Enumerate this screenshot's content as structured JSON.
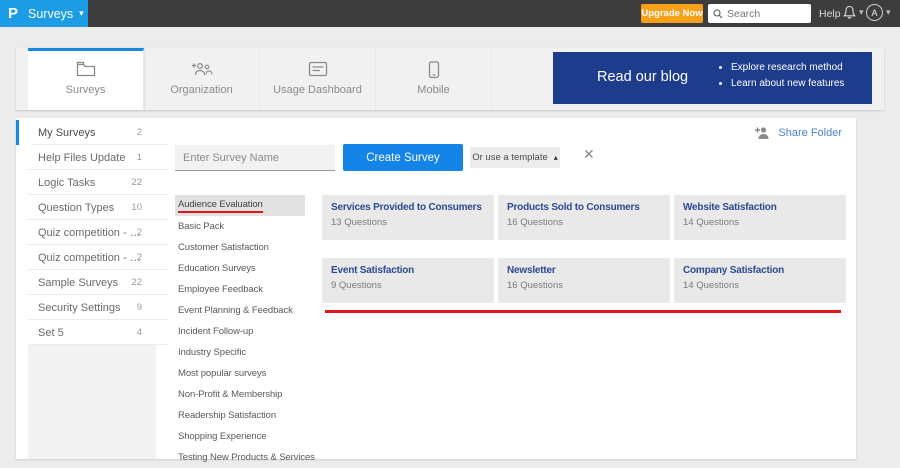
{
  "header": {
    "logo": "P",
    "app_menu_label": "Surveys",
    "upgrade_label": "Upgrade Now",
    "search_placeholder": "Search",
    "help_label": "Help",
    "avatar_letter": "A"
  },
  "tabs": [
    {
      "label": "Surveys"
    },
    {
      "label": "Organization"
    },
    {
      "label": "Usage Dashboard"
    },
    {
      "label": "Mobile"
    }
  ],
  "blog_banner": {
    "title": "Read our blog",
    "bullets": [
      "Explore research method",
      "Learn about new features"
    ]
  },
  "sidebar": {
    "items": [
      {
        "label": "My Surveys",
        "count": "2"
      },
      {
        "label": "Help Files Update",
        "count": "1"
      },
      {
        "label": "Logic Tasks",
        "count": "22"
      },
      {
        "label": "Question Types",
        "count": "10"
      },
      {
        "label": "Quiz competition - …",
        "count": "2"
      },
      {
        "label": "Quiz competition - …",
        "count": "2"
      },
      {
        "label": "Sample Surveys",
        "count": "22"
      },
      {
        "label": "Security Settings",
        "count": "9"
      },
      {
        "label": "Set 5",
        "count": "4"
      }
    ]
  },
  "toolbar": {
    "survey_name_placeholder": "Enter Survey Name",
    "create_button": "Create Survey",
    "template_dropdown": "Or use a template",
    "share_folder": "Share Folder"
  },
  "templates": {
    "selected_category": "Audience Evaluation",
    "categories": [
      "Audience Evaluation",
      "Basic Pack",
      "Customer Satisfaction",
      "Education Surveys",
      "Employee Feedback",
      "Event Planning & Feedback",
      "Incident Follow-up",
      "Industry Specific",
      "Most popular surveys",
      "Non-Profit & Membership",
      "Readership Satisfaction",
      "Shopping Experience",
      "Testing New Products & Services"
    ],
    "cards": [
      {
        "title": "Services Provided to Consumers",
        "questions": "13 Questions"
      },
      {
        "title": "Products Sold to Consumers",
        "questions": "16 Questions"
      },
      {
        "title": "Website Satisfaction",
        "questions": "14 Questions"
      },
      {
        "title": "Event Satisfaction",
        "questions": "9 Questions"
      },
      {
        "title": "Newsletter",
        "questions": "16 Questions"
      },
      {
        "title": "Company Satisfaction",
        "questions": "14 Questions"
      }
    ]
  },
  "colors": {
    "brand_blue": "#1b9ce4",
    "button_blue": "#1484e8",
    "active_tab_blue": "#1787e0",
    "banner_navy": "#1d3c8c",
    "upgrade_orange": "#f9a01b",
    "annotation_red": "#e1161f",
    "header_dark": "#3d3d3d"
  }
}
